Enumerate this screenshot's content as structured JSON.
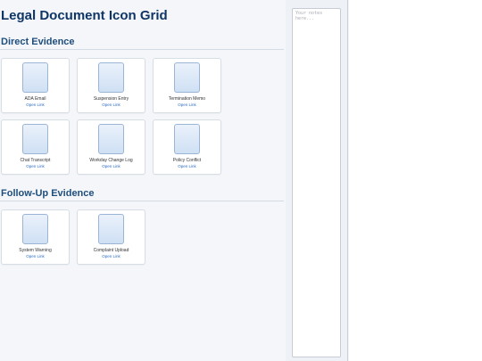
{
  "page_title": "Legal Document Icon Grid",
  "sections": [
    {
      "title": "Direct Evidence",
      "cards": [
        {
          "label": "ADA Email",
          "link": "Open Link"
        },
        {
          "label": "Suspension Entry",
          "link": "Open Link"
        },
        {
          "label": "Termination Memo",
          "link": "Open Link"
        },
        {
          "label": "Chat Transcript",
          "link": "Open Link"
        },
        {
          "label": "Workday Change Log",
          "link": "Open Link"
        },
        {
          "label": "Policy Conflict",
          "link": "Open Link"
        }
      ]
    },
    {
      "title": "Follow-Up Evidence",
      "cards": [
        {
          "label": "System Warning",
          "link": "Open Link"
        },
        {
          "label": "Complaint Upload",
          "link": "Open Link"
        }
      ]
    }
  ],
  "notes": {
    "placeholder": "Your notes here..."
  },
  "icons": {
    "card_icon": "document-icon"
  },
  "colors": {
    "title": "#0f3566",
    "section_title": "#1f4e7d",
    "link": "#2b6cc4",
    "icon_fill": "#cfe0f4"
  }
}
